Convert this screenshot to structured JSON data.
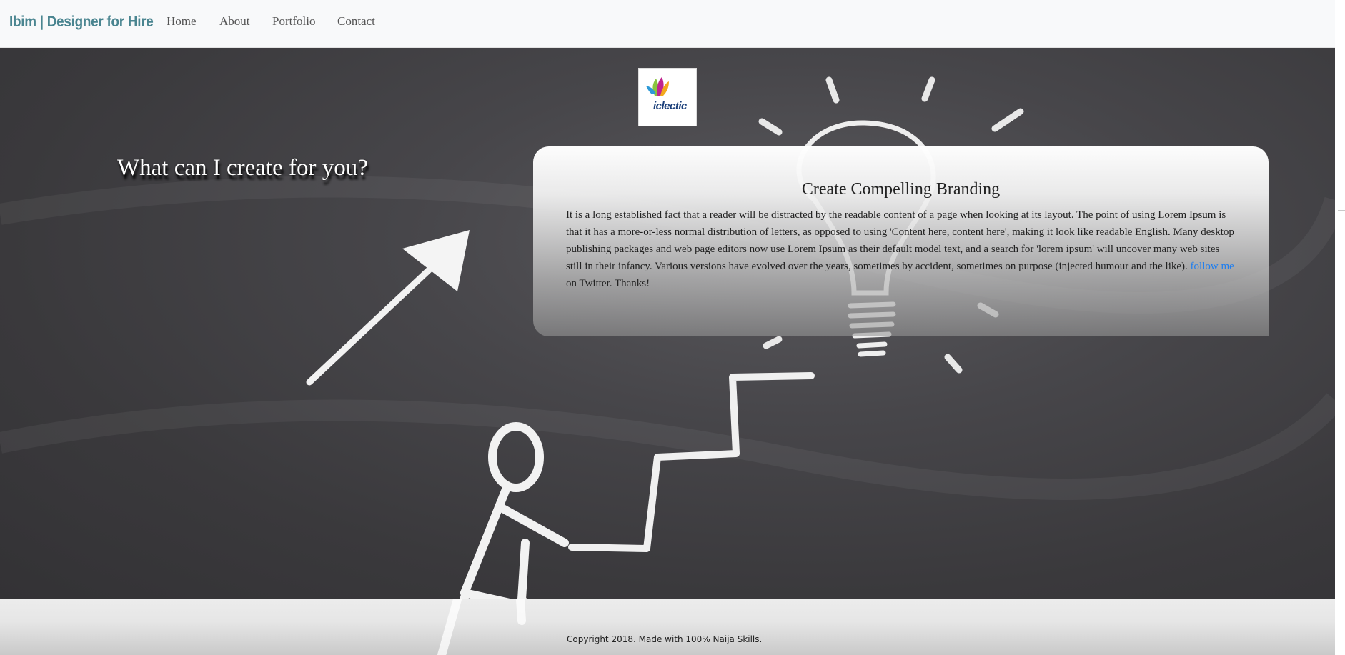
{
  "navbar": {
    "brand": "Ibim | Designer for Hire",
    "links": [
      {
        "label": "Home"
      },
      {
        "label": "About"
      },
      {
        "label": "Portfolio"
      },
      {
        "label": "Contact"
      }
    ]
  },
  "hero": {
    "logo_text": "iclectic",
    "title": "What can I create for you?",
    "card": {
      "heading": "Create Compelling Branding",
      "body": "It is a long established fact that a reader will be distracted by the readable content of a page when looking at its layout. The point of using Lorem Ipsum is that it has a more-or-less normal distribution of letters, as opposed to using 'Content here, content here', making it look like readable English. Many desktop publishing packages and web page editors now use Lorem Ipsum as their default model text, and a search for 'lorem ipsum' will uncover many web sites still in their infancy. Various versions have evolved over the years, sometimes by accident, sometimes on purpose (injected humour and the like).",
      "link_text": "follow me",
      "tail_text": " on Twitter. Thanks!"
    }
  },
  "footer": {
    "copyright": "Copyright 2018. Made with 100% Naija Skills."
  },
  "colors": {
    "brand": "#4a8590",
    "link": "#1e7ef0",
    "navbar_bg": "#f8f9fa",
    "chalkboard": "#3c3b3e"
  }
}
